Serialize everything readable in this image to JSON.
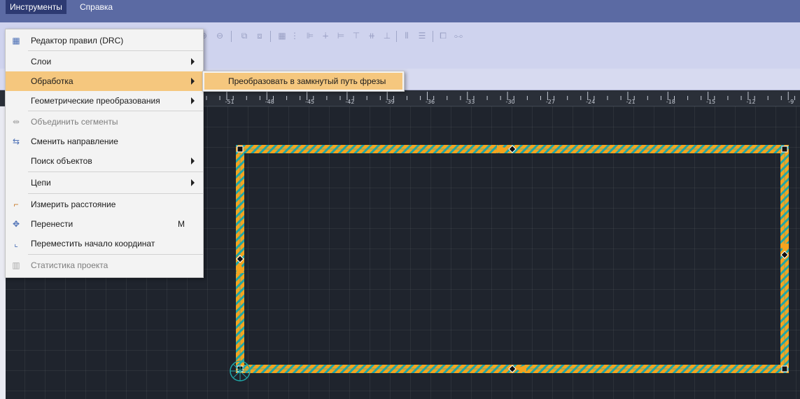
{
  "menubar": {
    "items": [
      {
        "label": "Инструменты",
        "active": true
      },
      {
        "label": "Справка",
        "active": false
      }
    ]
  },
  "tools_menu": {
    "items": [
      {
        "label": "Редактор правил (DRC)",
        "icon": "drc-table-icon",
        "enabled": true,
        "submenu": false,
        "shortcut": ""
      },
      {
        "label": "Слои",
        "icon": "",
        "enabled": true,
        "submenu": true,
        "shortcut": ""
      },
      {
        "label": "Обработка",
        "icon": "",
        "enabled": true,
        "submenu": true,
        "shortcut": "",
        "highlighted": true
      },
      {
        "label": "Геометрические преобразования",
        "icon": "",
        "enabled": true,
        "submenu": true,
        "shortcut": ""
      },
      {
        "label": "Объединить сегменты",
        "icon": "merge-segments-icon",
        "enabled": false,
        "submenu": false,
        "shortcut": ""
      },
      {
        "label": "Сменить направление",
        "icon": "reverse-direction-icon",
        "enabled": true,
        "submenu": false,
        "shortcut": ""
      },
      {
        "label": "Поиск объектов",
        "icon": "",
        "enabled": true,
        "submenu": true,
        "shortcut": ""
      },
      {
        "label": "Цепи",
        "icon": "",
        "enabled": true,
        "submenu": true,
        "shortcut": ""
      },
      {
        "label": "Измерить расстояние",
        "icon": "ruler-measure-icon",
        "enabled": true,
        "submenu": false,
        "shortcut": ""
      },
      {
        "label": "Перенести",
        "icon": "move-icon",
        "enabled": true,
        "submenu": false,
        "shortcut": "M"
      },
      {
        "label": "Переместить начало координат",
        "icon": "origin-icon",
        "enabled": true,
        "submenu": false,
        "shortcut": ""
      },
      {
        "label": "Статистика проекта",
        "icon": "statistics-icon",
        "enabled": false,
        "submenu": false,
        "shortcut": ""
      }
    ]
  },
  "processing_submenu": {
    "items": [
      {
        "label": "Преобразовать в замкнутый путь фрезы"
      }
    ]
  },
  "ruler": {
    "ticks": [
      "-51",
      "-48",
      "-45",
      "-42",
      "-39",
      "-36",
      "-33",
      "-30",
      "-27",
      "-24",
      "-21",
      "-18",
      "-15",
      "-12",
      "-9",
      "-6"
    ]
  },
  "colors": {
    "menubar": "#5b6aa3",
    "toolbar": "#cfd3ee",
    "canvas": "#1f242d",
    "highlight": "#f5c77e",
    "path_orange": "#f4a41f",
    "path_teal": "#1fa7a7"
  }
}
